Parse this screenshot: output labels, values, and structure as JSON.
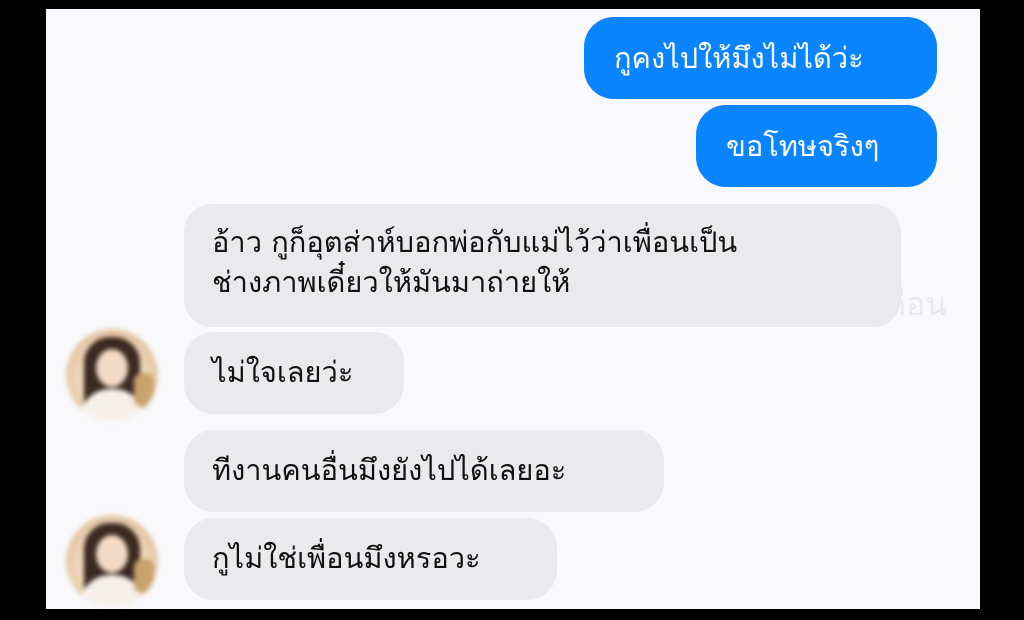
{
  "messages": {
    "sent": [
      "กูคงไปให้มึงไม่ได้ว่ะ",
      "ขอโทษจริงๆ"
    ],
    "received_first_line1": "อ้าว กูก็อุตส่าห์บอกพ่อกับแม่ไว้ว่าเพื่อนเป็น",
    "received_first_line2": "ช่างภาพเดี๋ยวให้มันมาถ่ายให้",
    "received": [
      "ไม่ใจเลยว่ะ",
      "ทีงานคนอื่นมึงยังไปได้เลยอะ",
      "กูไม่ใช่เพื่อนมึงหรอวะ"
    ]
  },
  "watermark": "ช่างภาพสายเถื่อน",
  "colors": {
    "sent_bubble": "#0a84ff",
    "received_bubble": "#eaeaec",
    "background": "#f9f9fb",
    "frame": "#000000"
  }
}
